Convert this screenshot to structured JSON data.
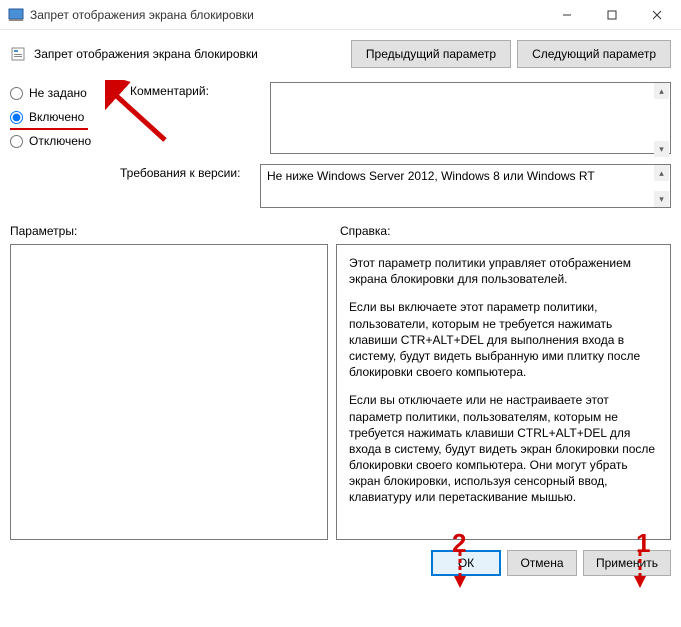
{
  "window": {
    "title": "Запрет отображения экрана блокировки"
  },
  "header": {
    "title": "Запрет отображения экрана блокировки",
    "prev_button": "Предыдущий параметр",
    "next_button": "Следующий параметр"
  },
  "radio": {
    "not_configured": "Не задано",
    "enabled": "Включено",
    "disabled": "Отключено",
    "selected": "enabled"
  },
  "labels": {
    "comment": "Комментарий:",
    "requirements": "Требования к версии:",
    "options": "Параметры:",
    "help": "Справка:"
  },
  "fields": {
    "comment_value": "",
    "requirements_value": "Не ниже Windows Server 2012, Windows 8 или Windows RT"
  },
  "help_text": {
    "p1": "Этот параметр политики управляет отображением экрана блокировки для пользователей.",
    "p2": "Если вы включаете этот параметр политики, пользователи, которым не требуется нажимать клавиши CTR+ALT+DEL для выполнения входа в систему, будут видеть выбранную ими плитку после блокировки своего компьютера.",
    "p3": "Если вы отключаете или не настраиваете этот параметр политики, пользователям, которым не требуется нажимать клавиши CTRL+ALT+DEL для входа в систему, будут видеть экран блокировки после блокировки своего компьютера. Они могут убрать экран блокировки, используя сенсорный ввод, клавиатуру или перетаскивание мышью."
  },
  "footer": {
    "ok": "ОК",
    "cancel": "Отмена",
    "apply": "Применить"
  },
  "annotations": {
    "num1": "1",
    "num2": "2"
  }
}
